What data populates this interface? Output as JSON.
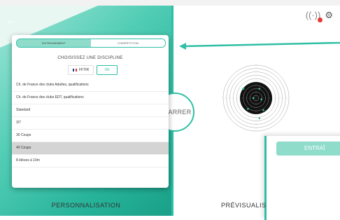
{
  "left": {
    "tabs": [
      {
        "label": "ENTRAINEMENT",
        "active": true
      },
      {
        "label": "COMPETITION",
        "active": false
      }
    ],
    "title": "CHOISISSEZ UNE DISCIPLINE",
    "filter_label": "FFTIR",
    "ok_label": "OK",
    "disciplines": [
      {
        "label": "Ch. de France des clubs Adultes, qualifications",
        "selected": false
      },
      {
        "label": "Ch. de France des clubs EDT, qualifications",
        "selected": false
      },
      {
        "label": "Standard",
        "selected": false
      },
      {
        "label": "3/7",
        "selected": false
      },
      {
        "label": "30 Coups",
        "selected": false
      },
      {
        "label": "40 Coups",
        "selected": true
      },
      {
        "label": "8 élèves à 10m",
        "selected": false
      }
    ],
    "bottom_label": "PERSONNALISATION"
  },
  "center": {
    "start_label": "ARRER"
  },
  "right": {
    "bottom_label": "PRÉVISUALIS",
    "peek_tab_label": "ENTRAÎ"
  },
  "icons": {
    "back": "arrow-left-icon",
    "signal": "signal-icon",
    "settings": "gear-icon"
  },
  "colors": {
    "accent": "#2fbfa6",
    "accent_light": "#8fdccb",
    "target_black": "#111111",
    "shot_dot": "#2fbfa6",
    "alert": "#e53935"
  }
}
